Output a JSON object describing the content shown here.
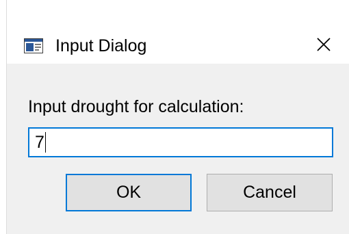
{
  "window": {
    "title": "Input Dialog",
    "icon": "window-app-icon",
    "close_icon": "close-icon",
    "accent_color": "#0078d7"
  },
  "form": {
    "label": "Input drought for calculation:",
    "input_value": "7"
  },
  "buttons": {
    "ok_label": "OK",
    "cancel_label": "Cancel"
  }
}
